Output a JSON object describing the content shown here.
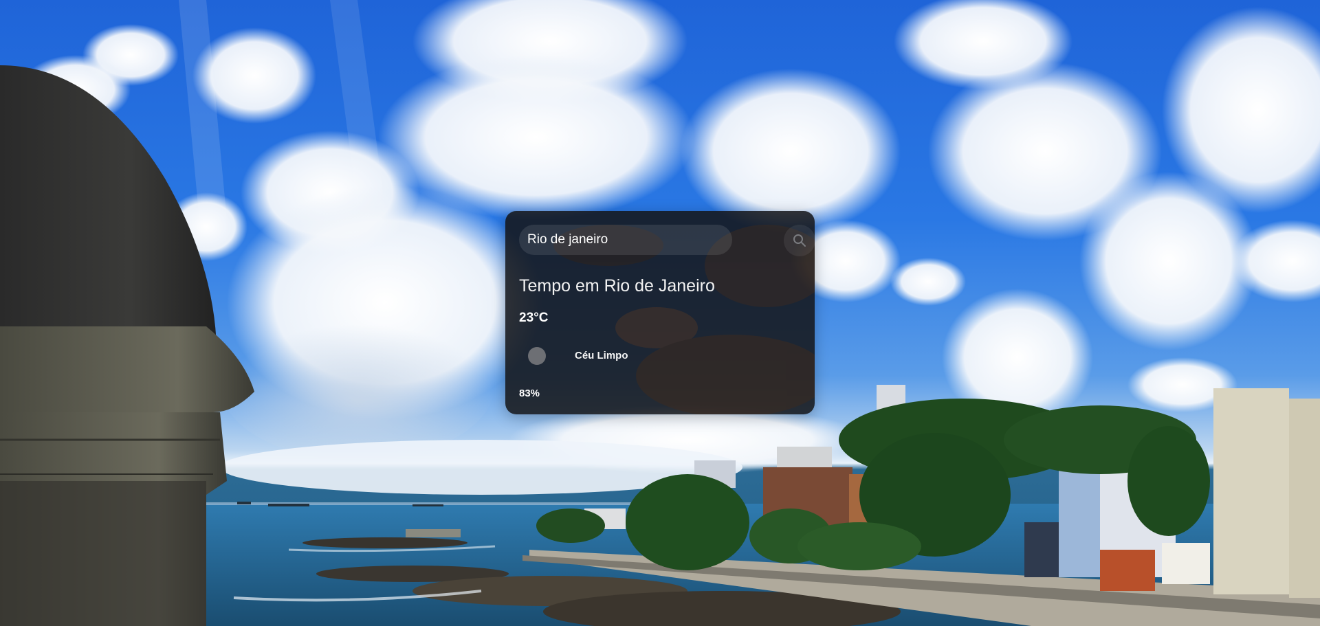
{
  "search": {
    "value": "Rio de janeiro",
    "icon": "search-icon"
  },
  "weather": {
    "title": "Tempo em Rio de Janeiro",
    "temperature": "23°C",
    "condition": "Céu Limpo",
    "condition_icon": "weather-icon",
    "humidity": "83%"
  },
  "colors": {
    "card_background": "#141416",
    "text": "#ffffff",
    "sky": "#2a78e4"
  }
}
